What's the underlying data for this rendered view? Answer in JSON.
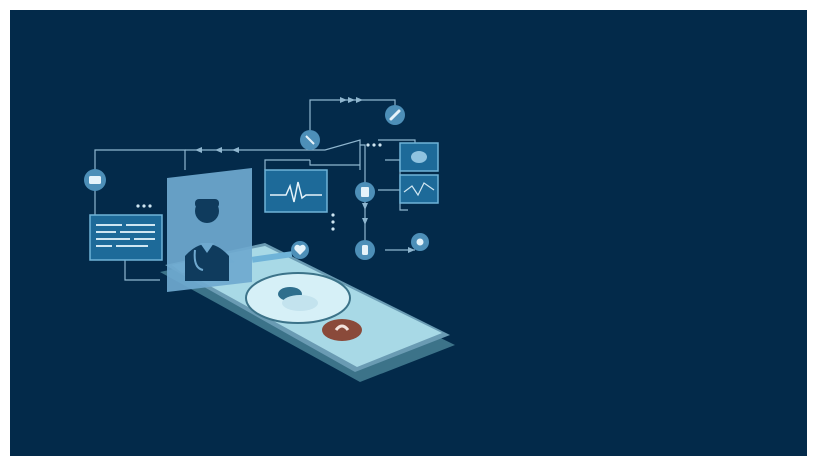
{
  "scene": {
    "description_visible_text": "",
    "colors": {
      "background": "#032a4a",
      "line": "#8fb6cf",
      "panel_fill": "#1d6a99",
      "panel_stroke": "#6fb3d8",
      "icon_circle": "#4d8fb8",
      "phone_screen": "#a8d9e6",
      "phone_body": "#6a9bb3",
      "call_button": "#8a4a3a",
      "doctor_card": "#6fa9cf"
    },
    "icons": [
      "camera-icon",
      "syringe-icon",
      "pill-icon",
      "clipboard-icon",
      "bottle-icon",
      "hand-touch-icon",
      "heart-icon",
      "ecg-icon",
      "doctor-avatar-icon",
      "phone-call-icon"
    ]
  }
}
